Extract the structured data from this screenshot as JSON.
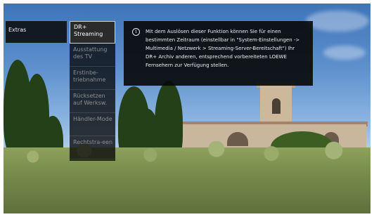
{
  "breadcrumb": {
    "label": "Extras"
  },
  "menu": {
    "items": [
      {
        "label": "DR+ Streaming",
        "selected": true
      },
      {
        "label": "Ausstattung des TV"
      },
      {
        "label": "Erstinbe-triebnahme"
      },
      {
        "label": "Rücksetzen auf Werksw."
      },
      {
        "label": "Händler-Mode"
      },
      {
        "label": "Rechtstra-een"
      }
    ]
  },
  "tooltip": {
    "icon": "info-icon",
    "text": "Mit dem Auslösen dieser Funktion können Sie für einen bestimmten Zeitraum (einstellbar in \"System-Einstellungen -> Multimedia / Netzwerk > Streaming-Server-Bereitschaft\") Ihr DR+ Archiv anderen, entsprechend vorbereiteten LOEWE Fernsehern zur Verfügung stellen."
  },
  "colors": {
    "overlay": "#080808",
    "active_border": "#d0d0d0",
    "inactive_text": "#8d8d8d"
  }
}
